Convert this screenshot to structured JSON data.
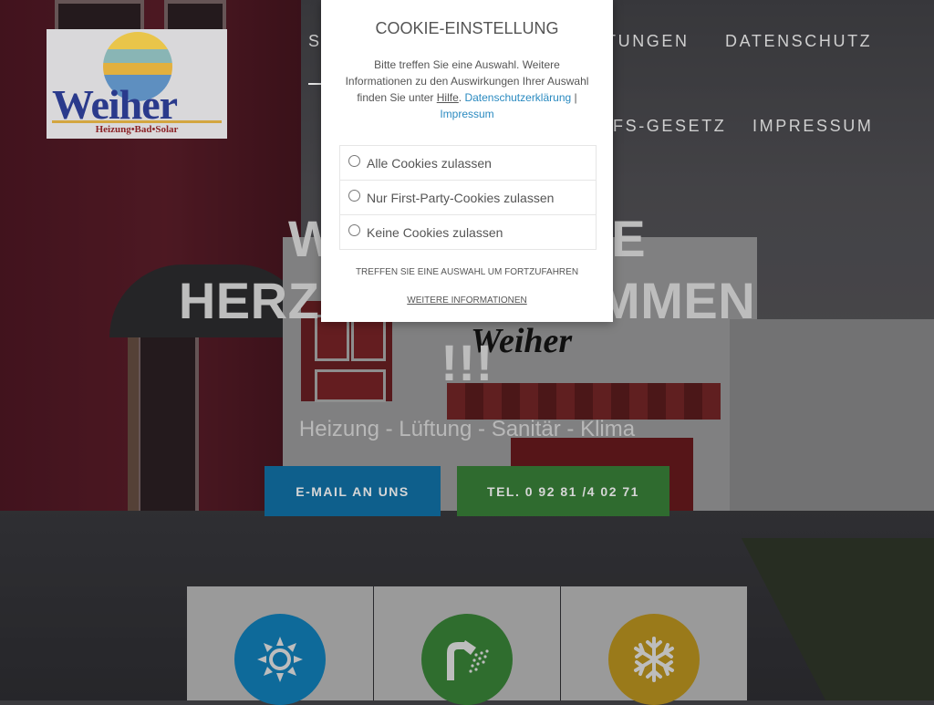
{
  "logo": {
    "wordmark": "Weiher",
    "tagline": "Heizung•Bad•Solar"
  },
  "sign": {
    "text": "Weiher"
  },
  "nav": {
    "items_row1": [
      "S",
      "TUNGEN",
      "DATENSCHUTZ"
    ],
    "items_row2": [
      "FS-GESETZ",
      "IMPRESSUM"
    ]
  },
  "hero": {
    "title_line1_left": "WIR",
    "title_line1_right": "SIE",
    "title_line2_left": "HERZL",
    "title_line2_right": "OMMEN",
    "title_line3": "!!!",
    "subtitle": "Heizung - Lüftung - Sanitär - Klima",
    "btn_email": "E-MAIL AN UNS",
    "btn_tel": "TEL. 0 92 81 /4 02 71"
  },
  "cards": [
    {
      "icon": "sun-icon",
      "color": "#0e6a9a"
    },
    {
      "icon": "shower-icon",
      "color": "#2f6d2e"
    },
    {
      "icon": "snowflake-icon",
      "color": "#9a7a1a"
    }
  ],
  "cookie": {
    "title": "COOKIE-EINSTELLUNG",
    "text_before": "Bitte treffen Sie eine Auswahl. Weitere Informationen zu den Auswirkungen Ihrer Auswahl finden Sie unter",
    "help_link": "Hilfe",
    "privacy_link": "Datenschutzerklärung",
    "separator": "|",
    "imprint_link": "Impressum",
    "options": [
      "Alle Cookies zulassen",
      "Nur First-Party-Cookies zulassen",
      "Keine Cookies zulassen"
    ],
    "note": "TREFFEN SIE EINE AUSWAHL UM FORTZUFAHREN",
    "more": "WEITERE INFORMATIONEN"
  }
}
